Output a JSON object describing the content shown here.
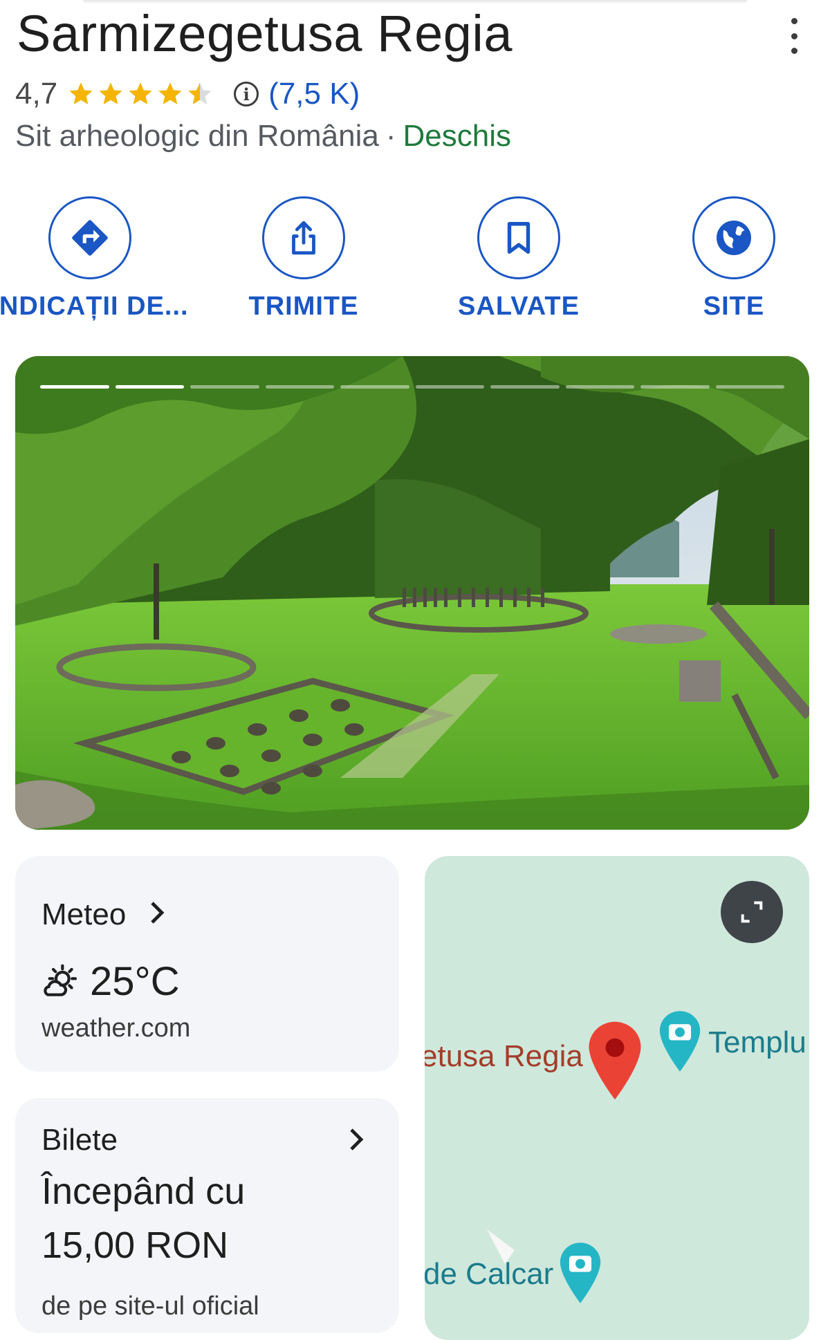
{
  "place": {
    "name": "Sarmizegetusa Regia",
    "rating": "4,7",
    "stars": 4.5,
    "review_count": "(7,5 K)",
    "category": "Sit arheologic din România",
    "separator": "·",
    "status": "Deschis"
  },
  "actions": [
    {
      "label": "INDICAȚII DE...",
      "icon": "directions-icon"
    },
    {
      "label": "TRIMITE",
      "icon": "share-icon"
    },
    {
      "label": "SALVATE",
      "icon": "bookmark-icon"
    },
    {
      "label": "SITE",
      "icon": "globe-icon"
    }
  ],
  "photos": {
    "total": 10,
    "current": 2
  },
  "weather": {
    "title": "Meteo",
    "temperature": "25°C",
    "icon": "partly-sunny-icon",
    "source": "weather.com"
  },
  "tickets": {
    "title": "Bilete",
    "line1": "Începând cu",
    "line2": "15,00 RON",
    "source": "de pe site-ul oficial"
  },
  "map": {
    "place_label": "etusa Regia",
    "poi_label_1": "Templu",
    "poi_label_2": "de Calcar"
  },
  "colors": {
    "accent": "#1a56c4",
    "open_status": "#1e7a3b",
    "star": "#f4b400",
    "map_pin": "#ea4335",
    "map_background": "#cfe8dc"
  }
}
